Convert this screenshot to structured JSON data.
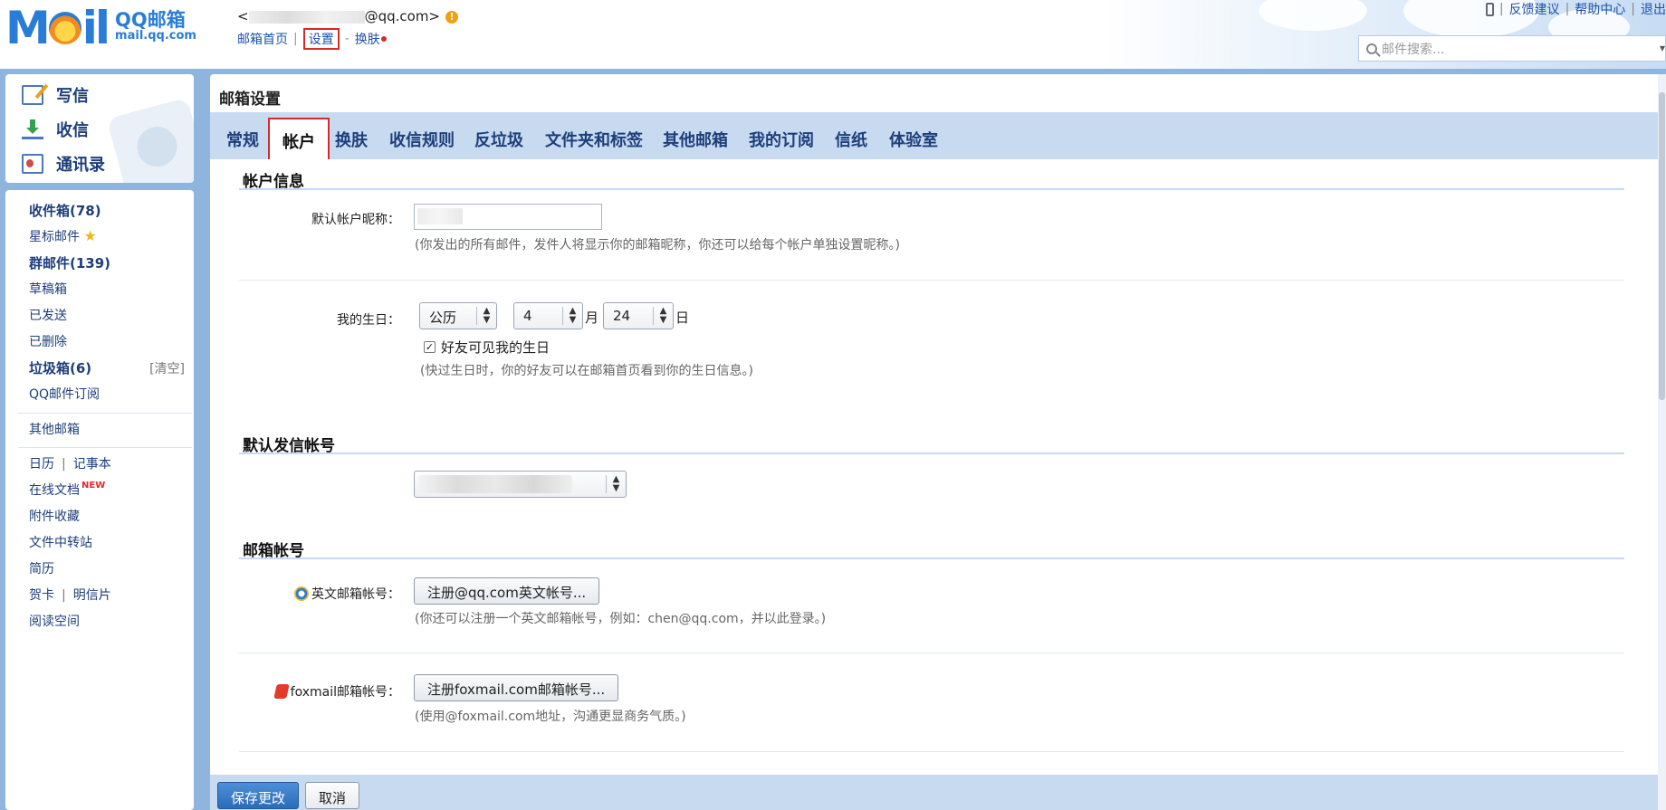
{
  "header": {
    "logo_mark": "M",
    "logo_mark2": "il",
    "logo_name": "QQ邮箱",
    "logo_domain": "mail.qq.com",
    "account_suffix": "@qq.com>",
    "account_prefix": "<",
    "warn_icon": "!",
    "links": {
      "home": "邮箱首页",
      "settings": "设置",
      "skin": "换肤"
    },
    "right_links": [
      "反馈建议",
      "帮助中心",
      "退出"
    ],
    "search_placeholder": "邮件搜索..."
  },
  "sidebar": {
    "compose": "写信",
    "receive": "收信",
    "contacts": "通讯录",
    "folders": {
      "inbox": "收件箱(78)",
      "starred": "星标邮件",
      "group": "群邮件(139)",
      "drafts": "草稿箱",
      "sent": "已发送",
      "deleted": "已删除",
      "spam": "垃圾箱(6)",
      "spam_clear": "[清空]",
      "subscription": "QQ邮件订阅",
      "other_mailbox": "其他邮箱",
      "calendar": "日历",
      "notepad": "记事本",
      "docs": "在线文档",
      "docs_badge": "NEW",
      "attachments": "附件收藏",
      "transfer": "文件中转站",
      "resume": "简历",
      "card": "贺卡",
      "postcard": "明信片",
      "reading": "阅读空间"
    }
  },
  "main": {
    "title": "邮箱设置",
    "tabs": [
      "常规",
      "帐户",
      "换肤",
      "收信规则",
      "反垃圾",
      "文件夹和标签",
      "其他邮箱",
      "我的订阅",
      "信纸",
      "体验室"
    ],
    "active_tab": "帐户",
    "account_info": {
      "title": "帐户信息",
      "nickname_label": "默认帐户昵称：",
      "nickname_hint": "(你发出的所有邮件，发件人将显示你的邮箱昵称，你还可以给每个帐户单独设置昵称。)",
      "birthday_label": "我的生日：",
      "calendar_value": "公历",
      "month_value": "4",
      "month_unit": "月",
      "day_value": "24",
      "day_unit": "日",
      "birthday_checkbox": "好友可见我的生日",
      "birthday_checked": true,
      "birthday_hint": "(快过生日时，你的好友可以在邮箱首页看到你的生日信息。)"
    },
    "default_sender": {
      "title": "默认发信帐号"
    },
    "mail_accounts": {
      "title": "邮箱帐号",
      "english_label": "英文邮箱帐号：",
      "english_button": "注册@qq.com英文帐号...",
      "english_hint": "(你还可以注册一个英文邮箱帐号，例如：chen@qq.com，并以此登录。)",
      "foxmail_label": "foxmail邮箱帐号：",
      "foxmail_button": "注册foxmail.com邮箱帐号...",
      "foxmail_hint": "(使用@foxmail.com地址，沟通更显商务气质。)"
    },
    "footer": {
      "save": "保存更改",
      "cancel": "取消"
    }
  },
  "colors": {
    "frame_blue": "#8fb4de",
    "tab_blue": "#c7daf0",
    "link_blue": "#1d52a8",
    "highlight_red": "#d62a2a",
    "primary_button": "#2b6cb8"
  },
  "icons": {
    "compose": "pencil-paper-icon",
    "receive": "download-tray-icon",
    "contacts": "contact-card-icon",
    "search": "search-icon",
    "phone": "phone-icon",
    "star": "star-icon",
    "english_account": "qq-mail-icon",
    "foxmail_account": "foxmail-icon"
  }
}
